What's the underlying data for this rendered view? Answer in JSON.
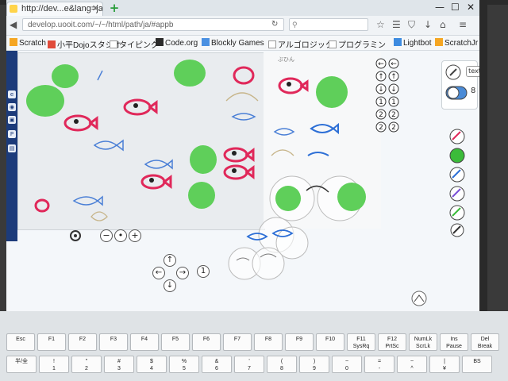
{
  "browser": {
    "tab_title": "http://dev...e&lang=ja",
    "url": "develop.uooit.com/~/~/html/path/ja/#appb",
    "search_placeholder": "",
    "new_tab_label": "+"
  },
  "bookmarks": [
    {
      "label": "Scratch"
    },
    {
      "label": "小平Dojoスタジオ"
    },
    {
      "label": "タイピング"
    },
    {
      "label": "Code.org"
    },
    {
      "label": "Blockly Games"
    },
    {
      "label": "アルゴロジック"
    },
    {
      "label": "プログラミン"
    },
    {
      "label": "Lightbot"
    },
    {
      "label": "ScratchJr"
    }
  ],
  "editor": {
    "panel_label": "ぶひん",
    "text_button": "text",
    "pen_count": "8",
    "pad_counter": "1",
    "step_label": "1"
  },
  "keyboard": {
    "fn_keys": [
      "Esc",
      "F1",
      "F2",
      "F3",
      "F4",
      "F5",
      "F6",
      "F7",
      "F8",
      "F9",
      "F10",
      "F11\nSysRq",
      "F12\nPrtSc",
      "NumLk\nScrLk",
      "Ins\nPause",
      "Del\nBreak"
    ],
    "num_keys": [
      "半/全",
      "!\n1",
      "\"\n2",
      "#\n3",
      "$\n4",
      "%\n5",
      "&\n6",
      "'\n7",
      "(\n8",
      ")\n9",
      "~\n0",
      "=\n-",
      "~\n^",
      "|\n¥",
      "BS"
    ]
  },
  "colors": {
    "accent_red": "#e0285a",
    "accent_blue": "#2d6fd6",
    "blob_green": "#5fcf5a"
  }
}
